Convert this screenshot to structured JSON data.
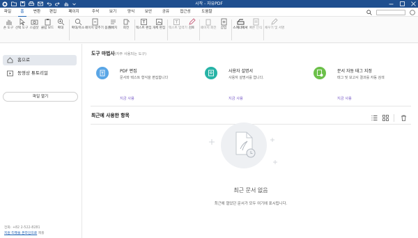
{
  "window": {
    "title": "시작 - 자유PDF"
  },
  "menu": {
    "items": [
      "파일",
      "홈",
      "변환",
      "편집",
      "페이지",
      "주석",
      "보기",
      "양식",
      "보안",
      "공유",
      "접근성",
      "도움말"
    ],
    "active": "홈",
    "account": "○"
  },
  "ribbon": {
    "buttons": [
      "손 도구",
      "선택 도구",
      "스냅샷",
      "클립 보드",
      "확대",
      "확대/축소",
      "페이지 맞추기 옵션",
      "재배치",
      "회전",
      "텍스트 편집",
      "개체 편집",
      "텍스트 입력기",
      "검토",
      "페이지 회전",
      "삽입",
      "스캐너에서",
      "빠른 인식",
      "채우기 및 서명"
    ]
  },
  "sidebar": {
    "items": [
      {
        "label": "홈으로",
        "icon": "home-icon"
      },
      {
        "label": "동영상 튜토리얼",
        "icon": "video-icon"
      }
    ],
    "open_button": "파일 열기",
    "phone": "전화: +82 2-522-8281",
    "support_link": "지원 티켓을 온라인으로",
    "support_suffix": " 제출"
  },
  "tools": {
    "title": "도구 마법사",
    "subtitle": "(자주 사용되는 도구)",
    "items": [
      {
        "name": "PDF 편집",
        "desc": "문서와 텍스트 형식을 편집합니다",
        "link": "지금 사용",
        "color": "#5aa6e6"
      },
      {
        "name": "사용자 설명서",
        "desc": "사용자 설명서를 엽니다.",
        "link": "지금 사용",
        "color": "#27b3a6"
      },
      {
        "name": "문서 자동 태그 지정",
        "desc": "태그 및 보고서 결과를 자동 검색",
        "link": "지금 사용",
        "color": "#6cc04a"
      }
    ]
  },
  "recent": {
    "title": "최근에 사용한 항목",
    "empty_title": "최근 문서 없음",
    "empty_desc": "최근에 열었던 문서가 모두 여기에 표시됩니다."
  }
}
